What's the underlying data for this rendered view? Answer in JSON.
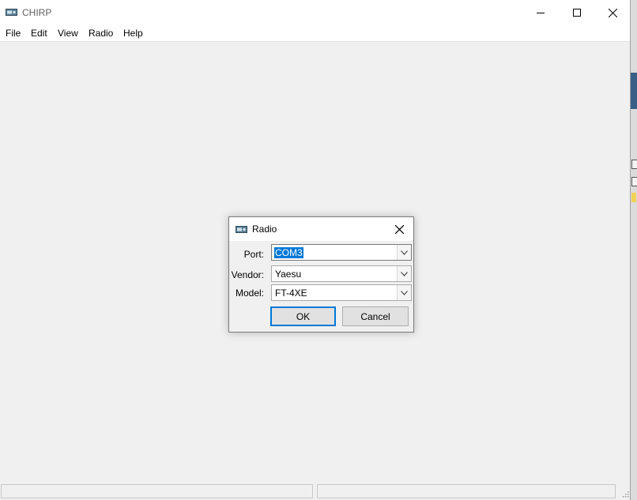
{
  "window": {
    "title": "CHIRP",
    "icon": "radio-icon",
    "controls": [
      "minimize-icon",
      "maximize-icon",
      "close-icon"
    ]
  },
  "menu": {
    "items": [
      {
        "label": "File"
      },
      {
        "label": "Edit"
      },
      {
        "label": "View"
      },
      {
        "label": "Radio"
      },
      {
        "label": "Help"
      }
    ]
  },
  "dialog": {
    "title": "Radio",
    "icon": "radio-icon",
    "fields": {
      "port": {
        "label": "Port:",
        "value": "COM3"
      },
      "vendor": {
        "label": "Vendor:",
        "value": "Yaesu"
      },
      "model": {
        "label": "Model:",
        "value": "FT-4XE"
      }
    },
    "ok_label": "OK",
    "cancel_label": "Cancel"
  },
  "colors": {
    "accent": "#0078d7",
    "window_bg": "#f0f0f0"
  }
}
